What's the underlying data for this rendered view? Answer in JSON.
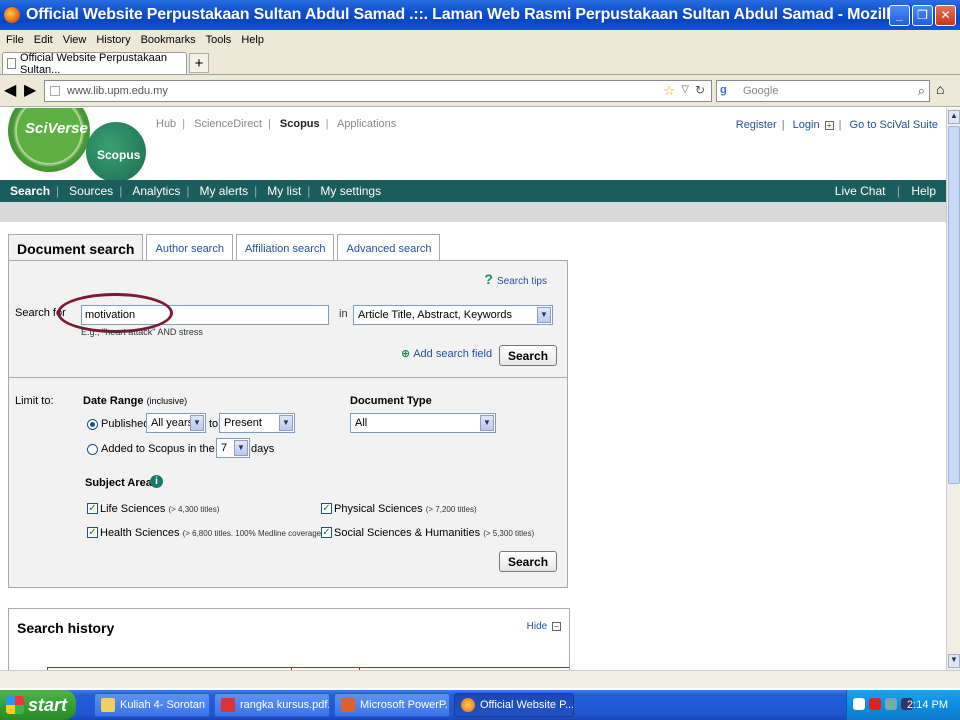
{
  "window": {
    "title": "Official Website Perpustakaan Sultan Abdul Samad .::. Laman Web Rasmi Perpustakaan Sultan Abdul Samad - Mozilla Firefox",
    "min": "_",
    "max": "❐",
    "close": "✕"
  },
  "menu": [
    "File",
    "Edit",
    "View",
    "History",
    "Bookmarks",
    "Tools",
    "Help"
  ],
  "tab": {
    "label": "Official Website Perpustakaan Sultan...",
    "new_tab": "+"
  },
  "nav": {
    "url": "www.lib.upm.edu.my",
    "search_placeholder": "Google",
    "search_engine": "g"
  },
  "site": {
    "logo": "SciVerse",
    "product": "Scopus",
    "toplinks": [
      "Hub",
      "ScienceDirect",
      "Scopus",
      "Applications"
    ],
    "rightlinks": {
      "register": "Register",
      "login": "Login",
      "scival": "Go to SciVal Suite"
    },
    "nav_items": [
      "Search",
      "Sources",
      "Analytics",
      "My alerts",
      "My list",
      "My settings"
    ],
    "nav_right": {
      "live_chat": "Live Chat",
      "help": "Help"
    }
  },
  "search": {
    "tabs": [
      "Document search",
      "Author search",
      "Affiliation search",
      "Advanced search"
    ],
    "tips": "Search tips",
    "search_for_label": "Search for",
    "query": "motivation",
    "example": "E.g., \"heart attack\" AND stress",
    "in_label": "in",
    "field": "Article Title, Abstract, Keywords",
    "add_field": "Add search field",
    "search_button": "Search",
    "limit_to": "Limit to:",
    "date_range_label": "Date Range",
    "date_range_note": "(inclusive)",
    "published_label": "Published",
    "from_year": "All years",
    "to_label": "to",
    "to_year": "Present",
    "added_label": "Added to Scopus in the last",
    "days_value": "7",
    "days_label": "days",
    "doc_type_label": "Document Type",
    "doc_type": "All",
    "subject_areas_label": "Subject Areas",
    "subjects": [
      {
        "name": "Life Sciences",
        "note": "(> 4,300 titles)",
        "checked": true
      },
      {
        "name": "Physical Sciences",
        "note": "(> 7,200 titles)",
        "checked": true
      },
      {
        "name": "Health Sciences",
        "note": "(> 6,800 titles. 100% Medline coverage)",
        "checked": true
      },
      {
        "name": "Social Sciences & Humanities",
        "note": "(> 5,300 titles)",
        "checked": true
      }
    ]
  },
  "history": {
    "title": "Search history",
    "hide": "Hide"
  },
  "taskbar": {
    "start": "start",
    "tasks": [
      "Kuliah 4- Sorotan ...",
      "rangka kursus.pdf...",
      "Microsoft PowerP...",
      "Official Website P..."
    ],
    "clock": "2:14 PM"
  }
}
